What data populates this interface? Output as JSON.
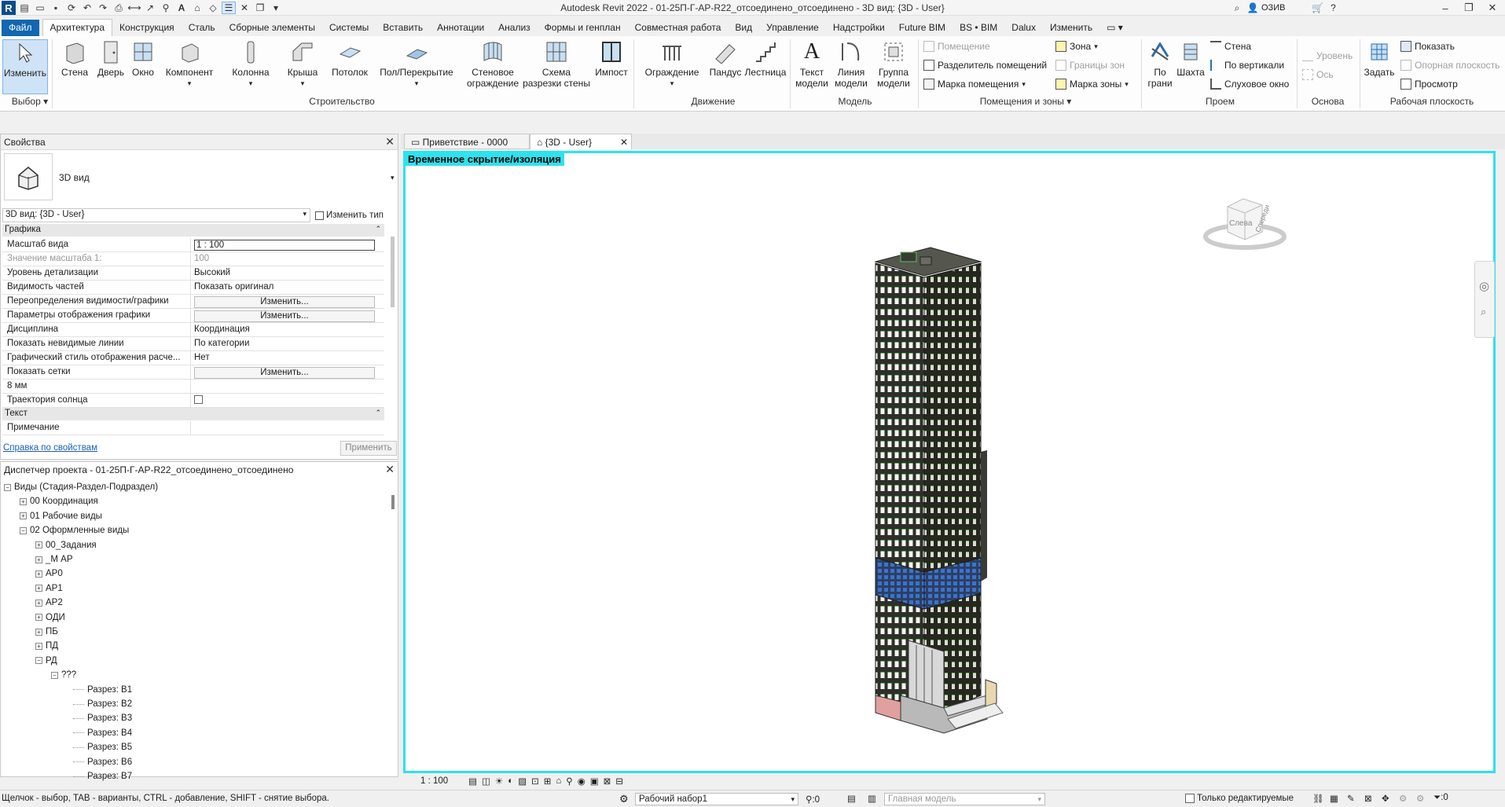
{
  "window": {
    "title": "Autodesk Revit 2022 - 01-25П-Г-АР-R22_отсоединено_отсоединено - 3D вид: {3D - User}",
    "user": "ОЗИВ"
  },
  "ribbon_tabs": [
    "Файл",
    "Архитектура",
    "Конструкция",
    "Сталь",
    "Сборные элементы",
    "Системы",
    "Вставить",
    "Аннотации",
    "Анализ",
    "Формы и генплан",
    "Совместная работа",
    "Вид",
    "Управление",
    "Надстройки",
    "Future BIM",
    "BS • BIM",
    "Dalux",
    "Изменить"
  ],
  "ribbon": {
    "select": {
      "modify": "Изменить",
      "group": "Выбор"
    },
    "build": {
      "wall": "Стена",
      "door": "Дверь",
      "window": "Окно",
      "component": "Компонент",
      "column": "Колонна",
      "roof": "Крыша",
      "ceiling": "Потолок",
      "floor": "Пол/Перекрытие",
      "curtain_system": "Стеновое ограждение",
      "curtain_grid": "Схема разрезки стены",
      "mullion": "Импост",
      "group": "Строительство"
    },
    "circulation": {
      "railing": "Ограждение",
      "ramp": "Пандус",
      "stair": "Лестница",
      "group": "Движение"
    },
    "model": {
      "model_text": "Текст модели",
      "model_line": "Линия модели",
      "model_group": "Группа модели",
      "group": "Модель"
    },
    "room": {
      "room": "Помещение",
      "room_separator": "Разделитель помещений",
      "room_tag": "Марка помещения",
      "area": "Зона",
      "area_boundary": "Границы зон",
      "area_tag": "Марка зоны",
      "group": "Помещения и зоны"
    },
    "opening": {
      "by_face": "По грани",
      "shaft": "Шахта",
      "wall": "Стена",
      "vertical": "По вертикали",
      "dormer": "Слуховое окно",
      "group": "Проем"
    },
    "datum": {
      "level": "Уровень",
      "grid": "Ось",
      "group": "Основа"
    },
    "workplane": {
      "set": "Задать",
      "show": "Показать",
      "ref_plane": "Опорная плоскость",
      "viewer": "Просмотр",
      "group": "Рабочая плоскость"
    }
  },
  "properties": {
    "title": "Свойства",
    "type_name": "3D вид",
    "instance": "3D вид: {3D - User}",
    "edit_type": "Изменить тип",
    "cat_graphics": "Графика",
    "rows": [
      {
        "k": "Масштаб вида",
        "v": "1 : 100"
      },
      {
        "k": "Значение масштаба    1:",
        "v": "100"
      },
      {
        "k": "Уровень детализации",
        "v": "Высокий"
      },
      {
        "k": "Видимость частей",
        "v": "Показать оригинал"
      },
      {
        "k": "Переопределения видимости/графики",
        "v": "Изменить..."
      },
      {
        "k": "Параметры отображения графики",
        "v": "Изменить..."
      },
      {
        "k": "Дисциплина",
        "v": "Координация"
      },
      {
        "k": "Показать невидимые линии",
        "v": "По категории"
      },
      {
        "k": "Графический стиль отображения расче...",
        "v": "Нет"
      },
      {
        "k": "Показать сетки",
        "v": "Изменить..."
      },
      {
        "k": "8 мм",
        "v": ""
      },
      {
        "k": "Траектория солнца",
        "v": ""
      }
    ],
    "cat_text": "Текст",
    "note": "Примечание",
    "help": "Справка по свойствам",
    "apply": "Применить"
  },
  "browser": {
    "title": "Диспетчер проекта - 01-25П-Г-АР-R22_отсоединено_отсоединено",
    "root": "Виды (Стадия-Раздел-Подраздел)",
    "l1": [
      "00 Координация",
      "01 Рабочие виды",
      "02 Оформленные виды"
    ],
    "l2": [
      "00_Задания",
      "_М АР",
      "АР0",
      "АР1",
      "АР2",
      "ОДИ",
      "ПБ",
      "ПД",
      "РД"
    ],
    "l3": "???",
    "l4": [
      "Разрез: В1",
      "Разрез: В2",
      "Разрез: В3",
      "Разрез: В4",
      "Разрез: В5",
      "Разрез: В6",
      "Разрез: В7"
    ]
  },
  "view": {
    "tabs": [
      "Приветствие - 0000",
      "{3D - User}"
    ],
    "iso_label": "Временное скрытие/изоляция",
    "viewcube": {
      "left": "Слева",
      "front": "Спереди"
    },
    "scale": "1 : 100"
  },
  "status": {
    "hint": "Щелчок - выбор, TAB - варианты, CTRL - добавление, SHIFT - снятие выбора.",
    "workset": "Рабочий набор1",
    "count": ":0",
    "model": "Главная модель",
    "editable": "Только редактируемые",
    "filter": ":0"
  }
}
